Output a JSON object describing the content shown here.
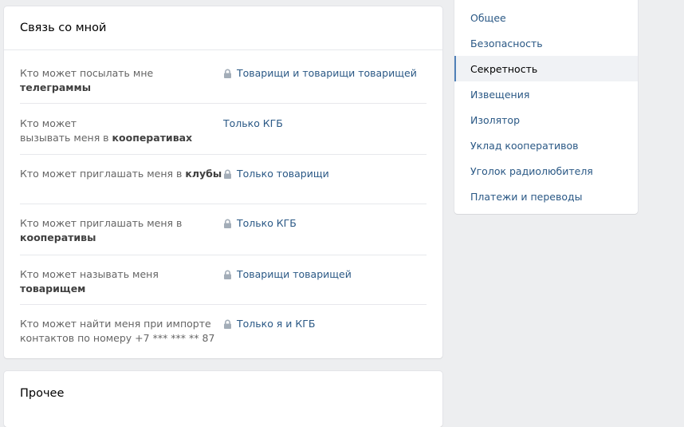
{
  "contact": {
    "title": "Связь со мной",
    "rows": [
      {
        "label_pre": "Кто может посылать мне ",
        "label_bold": "телеграммы",
        "label_post": "",
        "value": "Товарищи и товарищи товарищей",
        "locked": true
      },
      {
        "label_pre": "Кто может\nвызывать меня в ",
        "label_bold": "кооперативах",
        "label_post": "",
        "value": "Только КГБ",
        "locked": false
      },
      {
        "label_pre": "Кто может приглашать меня в ",
        "label_bold": "клубы",
        "label_post": "",
        "value": "Только товарищи",
        "locked": true
      },
      {
        "label_pre": "Кто может приглашать меня в\n",
        "label_bold": "кооперативы",
        "label_post": "",
        "value": "Только КГБ",
        "locked": true
      },
      {
        "label_pre": "Кто может называть меня ",
        "label_bold": "товарищем",
        "label_post": "",
        "value": "Товарищи товарищей",
        "locked": true
      },
      {
        "label_pre": "Кто может найти меня при импорте\nконтактов по номеру +7 *** *** ** 87",
        "label_bold": "",
        "label_post": "",
        "value": "Только я и КГБ",
        "locked": true
      }
    ]
  },
  "other": {
    "title": "Прочее"
  },
  "menu": {
    "items": [
      {
        "label": "Общее",
        "active": false
      },
      {
        "label": "Безопасность",
        "active": false
      },
      {
        "label": "Секретность",
        "active": true
      },
      {
        "label": "Извещения",
        "active": false
      },
      {
        "label": "Изолятор",
        "active": false
      },
      {
        "label": "Уклад кооперативов",
        "active": false
      },
      {
        "label": "Уголок радиолюбителя",
        "active": false
      },
      {
        "label": "Платежи и переводы",
        "active": false
      }
    ]
  },
  "colors": {
    "link": "#2a5885",
    "active_border": "#5181b8",
    "lock": "#a3adb8"
  }
}
